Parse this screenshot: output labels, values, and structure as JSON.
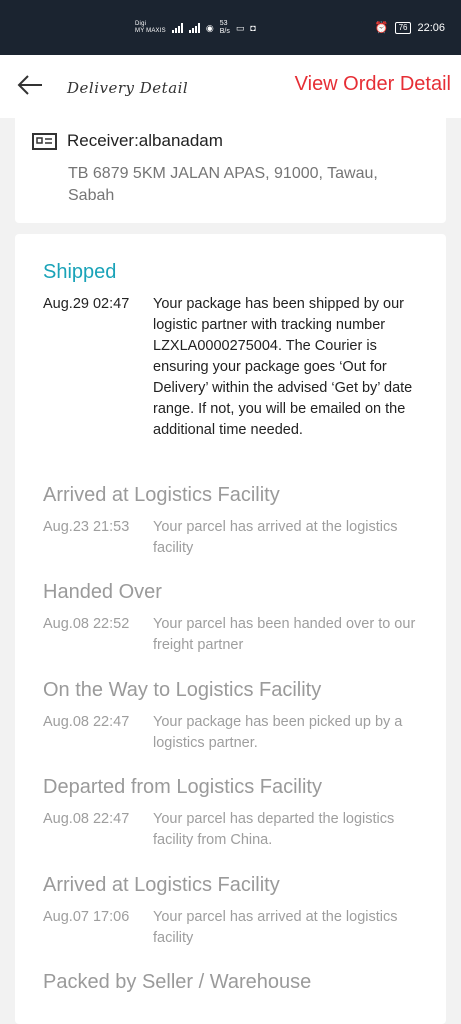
{
  "status_bar": {
    "carrier_line1": "Digi",
    "carrier_line2": "MY MAXIS",
    "network_speed": "53\nB/s",
    "battery": "76",
    "time": "22:06"
  },
  "header": {
    "title": "Delivery Detail",
    "view_order_label": "View Order Detail"
  },
  "receiver": {
    "label": "Receiver:albanadam",
    "address": "TB 6879 5KM JALAN APAS, 91000, Tawau, Sabah"
  },
  "tracking": [
    {
      "title": "Shipped",
      "time": "Aug.29 02:47",
      "description": "Your package has been shipped by our logistic partner with tracking number LZXLA0000275004. The Courier is ensuring your package goes ‘Out for Delivery’ within the advised ‘Get by’ date range. If not, you will be emailed on the additional time needed."
    },
    {
      "title": "Arrived at Logistics Facility",
      "time": "Aug.23 21:53",
      "description": "Your parcel has arrived at the logistics facility"
    },
    {
      "title": "Handed Over",
      "time": "Aug.08 22:52",
      "description": "Your parcel has been handed over to our freight partner"
    },
    {
      "title": "On the Way to Logistics Facility",
      "time": "Aug.08 22:47",
      "description": "Your package has been picked up by a logistics partner."
    },
    {
      "title": "Departed from Logistics Facility",
      "time": "Aug.08 22:47",
      "description": "Your parcel has departed the logistics facility from China."
    },
    {
      "title": "Arrived at Logistics Facility",
      "time": "Aug.07 17:06",
      "description": "Your parcel has arrived at the logistics facility"
    },
    {
      "title": "Packed by Seller / Warehouse",
      "time": "",
      "description": ""
    }
  ],
  "colors": {
    "accent_link": "#e62e35",
    "active_status": "#1aa3b8",
    "inactive_text": "#9e9e9e"
  },
  "icons": [
    "back-arrow-icon",
    "id-card-icon",
    "signal-icon",
    "wifi-icon",
    "alarm-icon",
    "battery-icon"
  ]
}
